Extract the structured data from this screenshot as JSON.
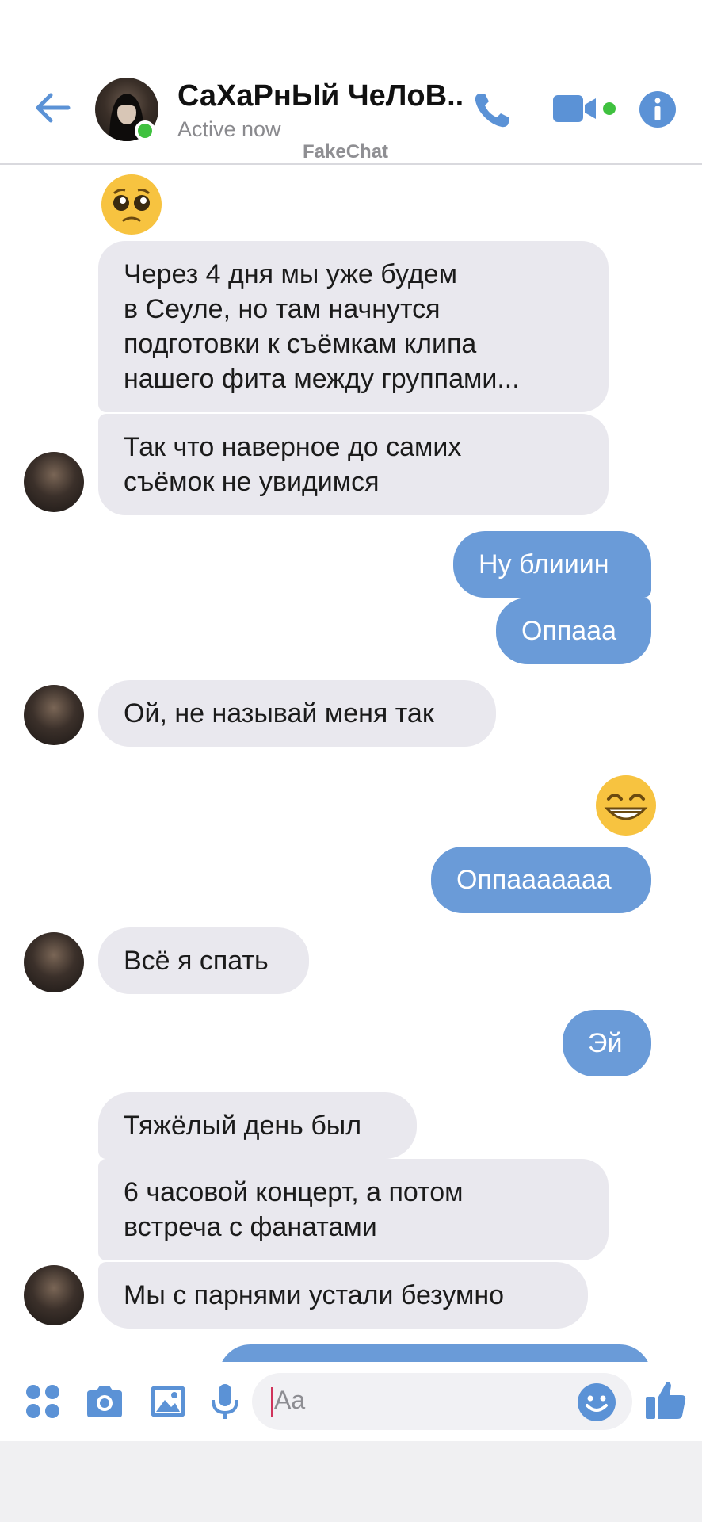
{
  "header": {
    "contact_name": "СаХаРнЫй ЧеЛоВ...",
    "status": "Active now",
    "watermark": "FakeChat",
    "accent_color": "#5b92d6"
  },
  "messages": [
    {
      "side": "in",
      "type": "emoji",
      "icon": "pleading-face-emoji"
    },
    {
      "side": "in",
      "type": "text",
      "text": " Через 4 дня мы уже будем\nв Сеуле, но там начнутся\nподготовки к съёмкам клипа\nнашего фита между группами..."
    },
    {
      "side": "in",
      "type": "text",
      "text": "Так что наверное до самих\nсъёмок не увидимся"
    },
    {
      "side": "out",
      "type": "text",
      "text": "Ну блииин"
    },
    {
      "side": "out",
      "type": "text",
      "text": "Оппааа"
    },
    {
      "side": "in",
      "type": "text",
      "text": "Ой, не называй меня так"
    },
    {
      "side": "out",
      "type": "emoji",
      "icon": "grinning-face-emoji"
    },
    {
      "side": "out",
      "type": "text",
      "text": "Оппаааааaa"
    },
    {
      "side": "in",
      "type": "text",
      "text": "Всё я спать"
    },
    {
      "side": "out",
      "type": "text",
      "text": "Эй"
    },
    {
      "side": "in",
      "type": "text",
      "text": "Тяжёлый день был"
    },
    {
      "side": "in",
      "type": "text",
      "text": "6 часовой концерт, а потом\nвстреча с фанатами"
    },
    {
      "side": "in",
      "type": "text",
      "text": "Мы с парнями устали безумно"
    }
  ],
  "composer": {
    "placeholder": "Aa",
    "icons": [
      "apps-icon",
      "camera-icon",
      "image-icon",
      "microphone-icon",
      "emoji-icon",
      "thumbs-up-icon"
    ]
  },
  "colors": {
    "incoming_bubble": "#e9e8ee",
    "outgoing_bubble": "#6a9bd8",
    "online": "#3fc13f"
  }
}
